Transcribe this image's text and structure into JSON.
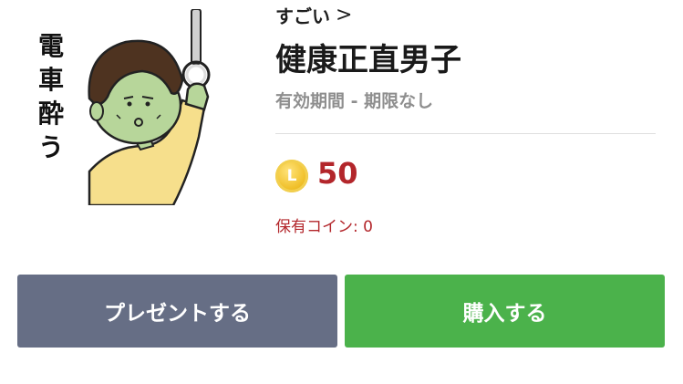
{
  "sticker": {
    "creator": "すごい",
    "title": "健康正直男子",
    "validity": "有効期間 - 期限なし",
    "thumbnail_caption": "電車酔う",
    "coin_icon_letter": "L",
    "price": "50",
    "owned_coins": "保有コイン: 0"
  },
  "actions": {
    "present_label": "プレゼントする",
    "buy_label": "購入する"
  },
  "colors": {
    "price_red": "#b3262b",
    "present_button": "#666e85",
    "buy_button": "#4bb24b",
    "coin_gold": "#f0c02a"
  },
  "icons": {
    "creator_link": "chevron-right-icon",
    "coin": "line-coin-icon"
  }
}
